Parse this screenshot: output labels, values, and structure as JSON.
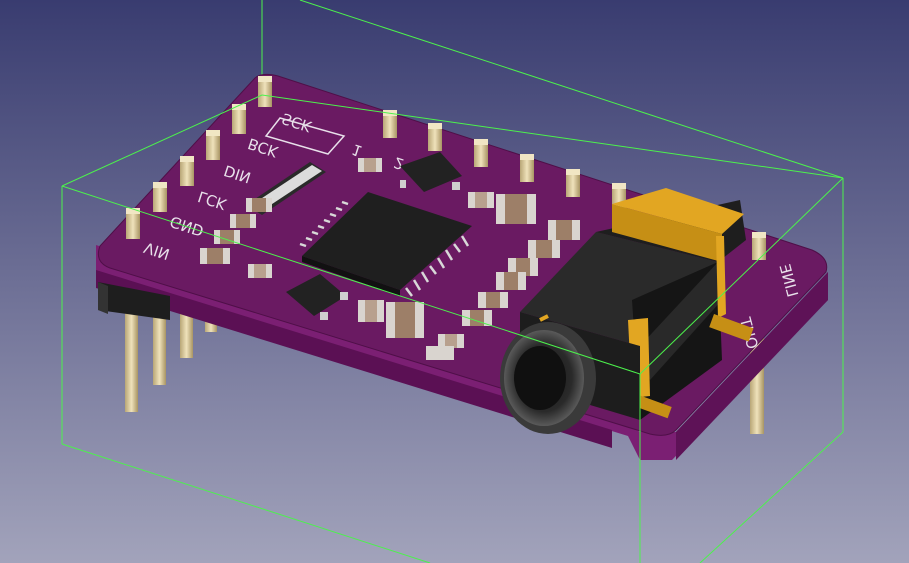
{
  "viewport": {
    "background_top": "#3a3d72",
    "background_bottom": "#9a9cb6",
    "bounding_box_color": "#4cf24c"
  },
  "board": {
    "pcb_color": "#6a1a62",
    "silkscreen_color": "#e8e0ea",
    "pin_color": "#d8c79a",
    "labels": {
      "sck": "SCK",
      "bck": "BCK",
      "din": "DIN",
      "lck": "LCK",
      "gnd": "GND",
      "vin": "VIN",
      "pin1": "1",
      "pin2": "2",
      "line": "LINE",
      "out": "OUT"
    }
  }
}
